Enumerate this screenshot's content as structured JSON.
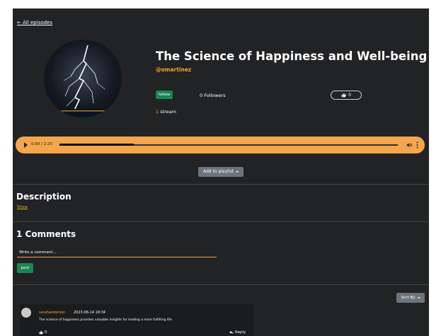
{
  "nav": {
    "back_label": "← All episodes"
  },
  "episode": {
    "title": "The Science of Happiness and Well-being",
    "author": "@omartinez",
    "follow_label": "follow",
    "followers": "0 Followers",
    "likes": "0",
    "stream_count": "1",
    "stream_label": "stream"
  },
  "player": {
    "time": "0:00 / 2:20",
    "progress_fraction": 0.22,
    "accent_color": "#f3a64a"
  },
  "playlist": {
    "label": "Add to playlist"
  },
  "description": {
    "heading": "Description",
    "toggle": "Show"
  },
  "comments": {
    "heading": "1 Comments",
    "input_placeholder": "Write a comment...",
    "post_label": "post",
    "sort_label": "Sort By",
    "items": [
      {
        "author": "sarahanderson",
        "date": "2023-06-14 18:34",
        "text": "The science of happiness provides valuable insights for leading a more fulfilling life.",
        "likes": "0",
        "reply_label": "Reply"
      }
    ]
  },
  "colors": {
    "accent": "#f5a623",
    "success": "#198754",
    "secondary": "#6c757d",
    "background": "#222325"
  }
}
